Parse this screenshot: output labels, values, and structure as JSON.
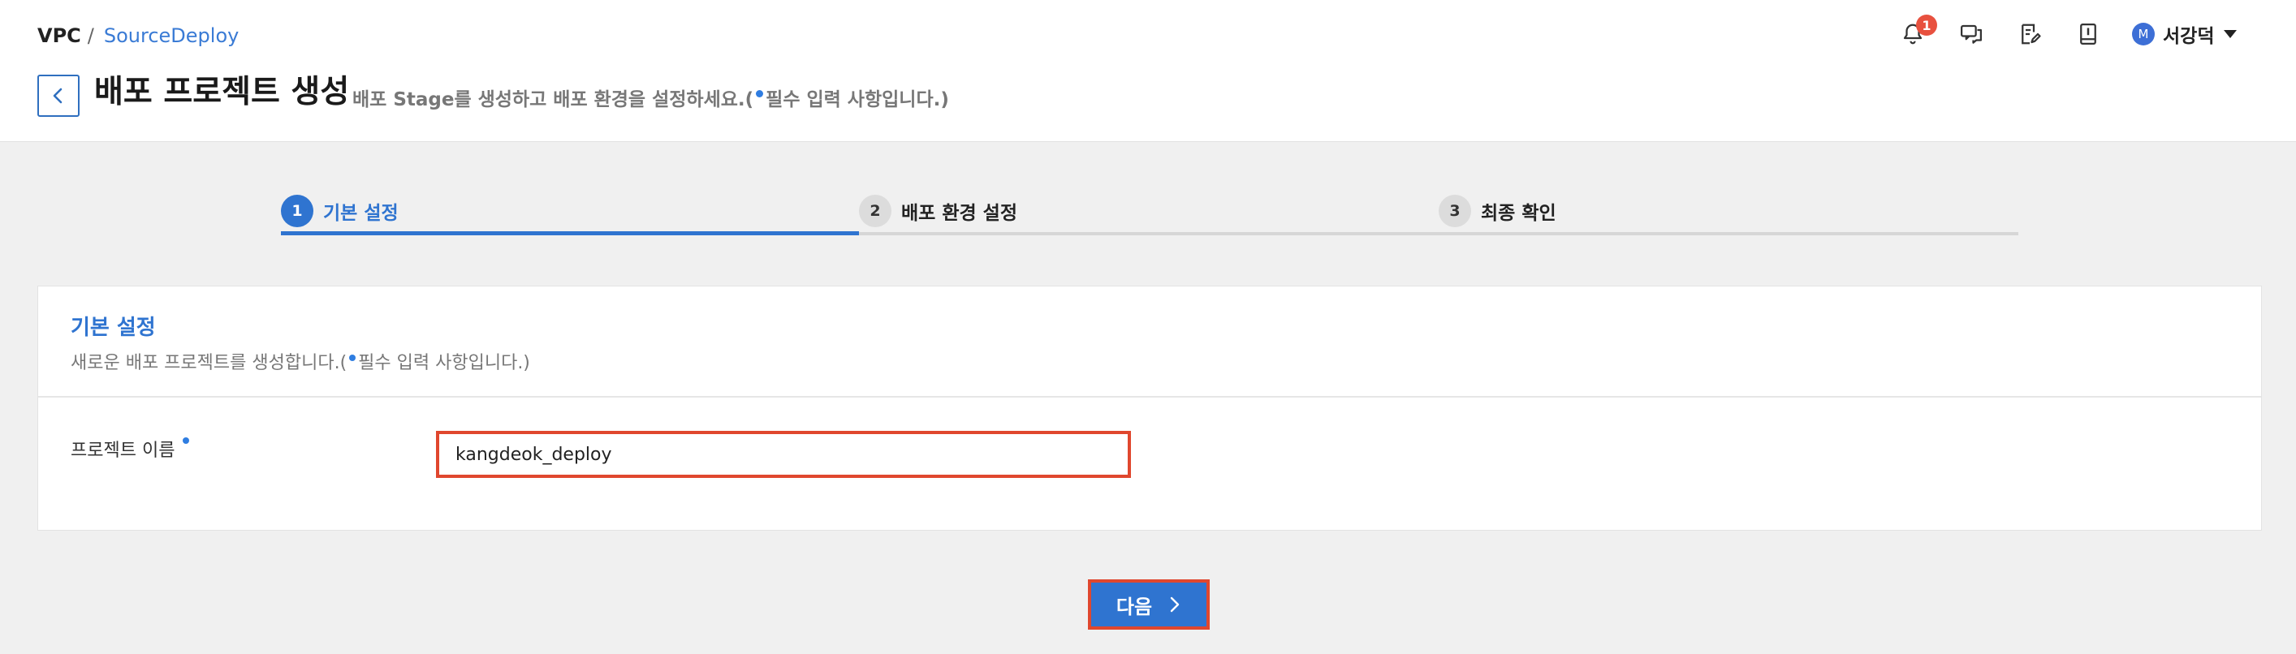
{
  "breadcrumb": {
    "root": "VPC",
    "separator": "/",
    "current": "SourceDeploy"
  },
  "header": {
    "title": "배포 프로젝트 생성",
    "subtitle_prefix": "배포 Stage를 생성하고 배포 환경을 설정하세요.(",
    "subtitle_suffix": "필수 입력 사항입니다.)"
  },
  "topbar": {
    "notification_count": "1",
    "icons": [
      "bell-icon",
      "chat-icon",
      "edit-note-icon",
      "book-icon"
    ],
    "user": {
      "avatar_initial": "M",
      "name": "서강덕"
    }
  },
  "stepper": {
    "steps": [
      {
        "number": "1",
        "label": "기본 설정",
        "active": true
      },
      {
        "number": "2",
        "label": "배포 환경 설정",
        "active": false
      },
      {
        "number": "3",
        "label": "최종 확인",
        "active": false
      }
    ]
  },
  "card": {
    "title": "기본 설정",
    "description_prefix": "새로운 배포 프로젝트를 생성합니다.(",
    "description_suffix": "필수 입력 사항입니다.)",
    "fields": {
      "project_name": {
        "label": "프로젝트 이름",
        "value": "kangdeok_deploy"
      }
    }
  },
  "actions": {
    "next_label": "다음"
  },
  "colors": {
    "accent": "#2f74d0",
    "highlight": "#e0472e",
    "required_dot": "#2f7de1",
    "badge": "#e8513f"
  }
}
